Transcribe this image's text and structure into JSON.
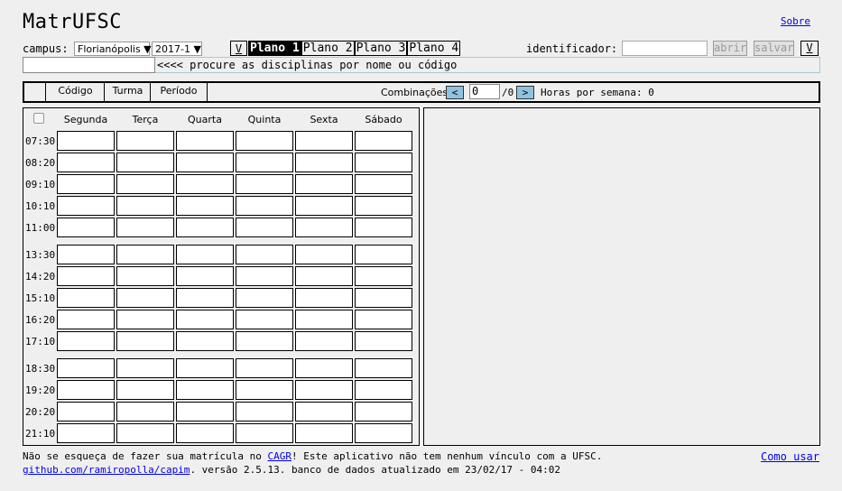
{
  "app": {
    "title": "MatrUFSC",
    "about_label": "Sobre"
  },
  "campus": {
    "label": "campus:",
    "selected": "Florianópolis ▼",
    "semester": "2017-1 ▼"
  },
  "plans": {
    "toggle_label": "V",
    "tabs": [
      "Plano 1",
      "Plano 2",
      "Plano 3",
      "Plano 4"
    ],
    "active_index": 0
  },
  "identifier": {
    "label": "identificador:",
    "value": "",
    "open_label": "abrir",
    "save_label": "salvar",
    "toggle_label": "V"
  },
  "search": {
    "value": "",
    "hint": "<<<< procure as disciplinas por nome ou código"
  },
  "table_header": {
    "columns": [
      "Código",
      "Turma",
      "Período"
    ],
    "combinations_label": "Combinações",
    "prev_label": "<",
    "next_label": ">",
    "combination_value": "0",
    "combination_total": "/0",
    "hours_label": "Horas por semana: 0"
  },
  "schedule": {
    "days": [
      "Segunda",
      "Terça",
      "Quarta",
      "Quinta",
      "Sexta",
      "Sábado"
    ],
    "times": [
      "07:30",
      "08:20",
      "09:10",
      "10:10",
      "11:00",
      "13:30",
      "14:20",
      "15:10",
      "16:20",
      "17:10",
      "18:30",
      "19:20",
      "20:20",
      "21:10"
    ]
  },
  "footer": {
    "line1_prefix": "Não se esqueça de fazer sua matrícula no ",
    "line1_link": "CAGR",
    "line1_suffix": "! Este aplicativo não tem nenhum vínculo com a UFSC.",
    "line2_link": "github.com/ramiropolla/capim",
    "line2_suffix": ". versão 2.5.13. banco de dados atualizado em 23/02/17 - 04:02",
    "howto_label": "Como usar"
  },
  "colors": {
    "nav_button": "#8ec3e0",
    "link": "#0000ee",
    "active_tab_bg": "#000000"
  }
}
